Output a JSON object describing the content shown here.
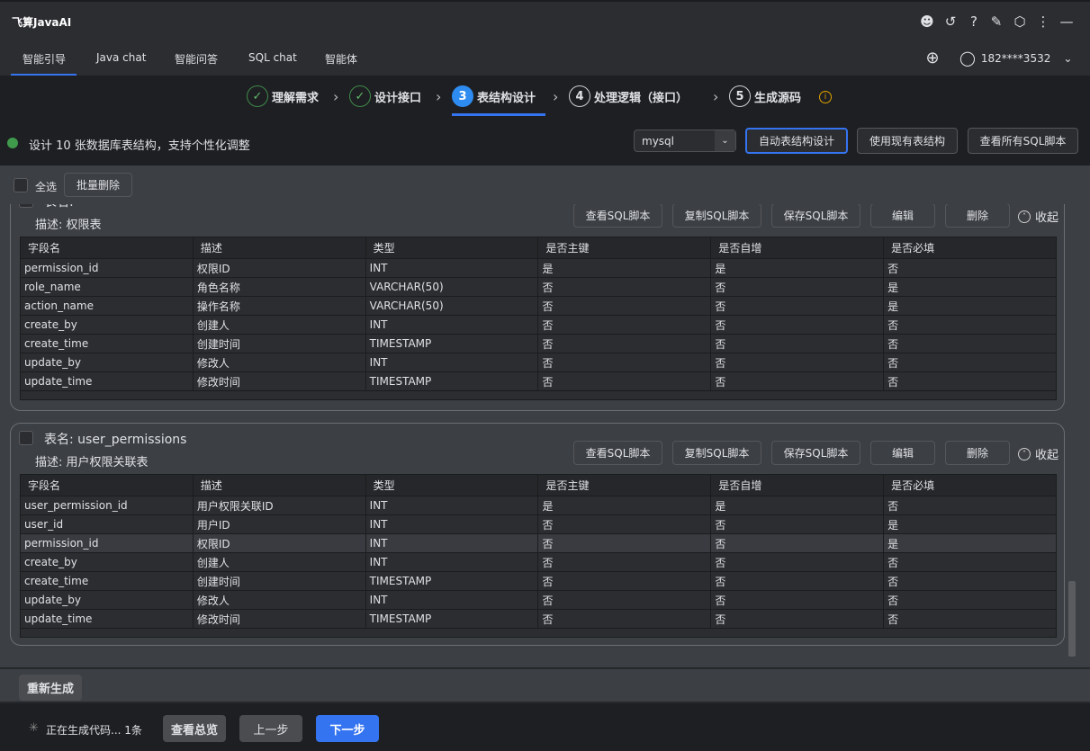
{
  "app": {
    "title": "飞算JavaAI",
    "user": "182****3532"
  },
  "tabs": [
    "智能引导",
    "Java chat",
    "智能问答",
    "SQL chat",
    "智能体"
  ],
  "steps": [
    {
      "label": "理解需求",
      "state": "done",
      "marker": "✓"
    },
    {
      "label": "设计接口",
      "state": "done",
      "marker": "✓"
    },
    {
      "label": "表结构设计",
      "state": "active",
      "marker": "3"
    },
    {
      "label": "处理逻辑（接口）",
      "state": "pending",
      "marker": "4"
    },
    {
      "label": "生成源码",
      "state": "pending",
      "marker": "5"
    }
  ],
  "status": {
    "text": "设计 10 张数据库表结构，支持个性化调整",
    "db_select": "mysql",
    "auto_btn": "自动表结构设计",
    "use_existing_btn": "使用现有表结构",
    "view_all_btn": "查看所有SQL脚本"
  },
  "toolbar": {
    "select_all": "全选",
    "batch_delete": "批量删除"
  },
  "card_actions": {
    "view": "查看SQL脚本",
    "copy": "复制SQL脚本",
    "save": "保存SQL脚本",
    "edit": "编辑",
    "delete": "删除",
    "collapse": "收起"
  },
  "columns": [
    "字段名",
    "描述",
    "类型",
    "是否主键",
    "是否自增",
    "是否必填"
  ],
  "tables": [
    {
      "name_label": "表名: ",
      "name": "",
      "desc": "描述: 权限表",
      "rows": [
        [
          "permission_id",
          "权限ID",
          "INT",
          "是",
          "是",
          "否"
        ],
        [
          "role_name",
          "角色名称",
          "VARCHAR(50)",
          "否",
          "否",
          "是"
        ],
        [
          "action_name",
          "操作名称",
          "VARCHAR(50)",
          "否",
          "否",
          "是"
        ],
        [
          "create_by",
          "创建人",
          "INT",
          "否",
          "否",
          "否"
        ],
        [
          "create_time",
          "创建时间",
          "TIMESTAMP",
          "否",
          "否",
          "否"
        ],
        [
          "update_by",
          "修改人",
          "INT",
          "否",
          "否",
          "否"
        ],
        [
          "update_time",
          "修改时间",
          "TIMESTAMP",
          "否",
          "否",
          "否"
        ]
      ]
    },
    {
      "name_label": "表名: user_permissions",
      "desc": "描述: 用户权限关联表",
      "rows": [
        [
          "user_permission_id",
          "用户权限关联ID",
          "INT",
          "是",
          "是",
          "否"
        ],
        [
          "user_id",
          "用户ID",
          "INT",
          "否",
          "否",
          "是"
        ],
        [
          "permission_id",
          "权限ID",
          "INT",
          "否",
          "否",
          "是"
        ],
        [
          "create_by",
          "创建人",
          "INT",
          "否",
          "否",
          "否"
        ],
        [
          "create_time",
          "创建时间",
          "TIMESTAMP",
          "否",
          "否",
          "否"
        ],
        [
          "update_by",
          "修改人",
          "INT",
          "否",
          "否",
          "否"
        ],
        [
          "update_time",
          "修改时间",
          "TIMESTAMP",
          "否",
          "否",
          "否"
        ]
      ]
    }
  ],
  "footer": {
    "regenerate": "重新生成",
    "progress": "正在生成代码... 1条",
    "overview": "查看总览",
    "prev": "上一步",
    "next": "下一步"
  },
  "colors": {
    "accent": "#3574f0",
    "step_active": "#2e8cf0",
    "done": "#3f8a4a",
    "warn": "#e0a300"
  }
}
